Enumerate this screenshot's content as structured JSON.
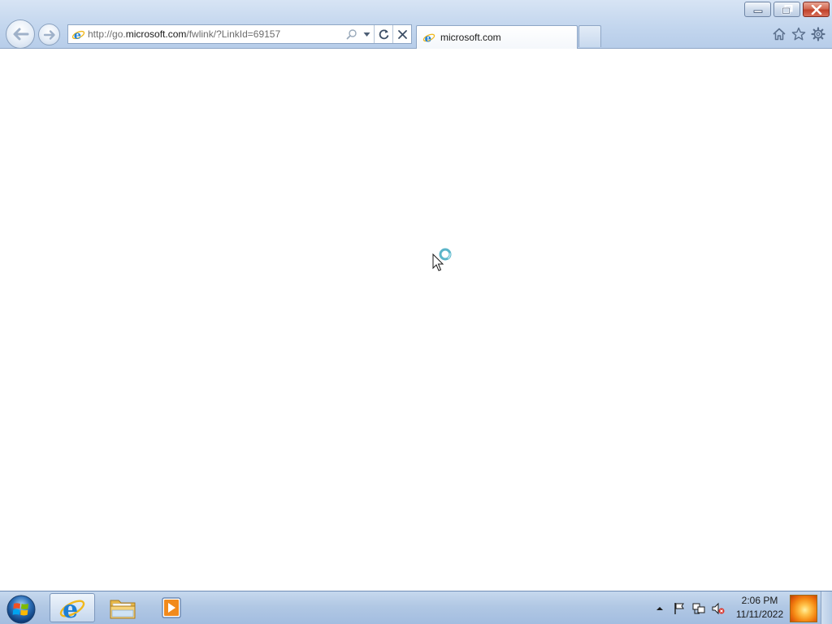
{
  "browser": {
    "address_url_prefix": "http://go.",
    "address_url_domain": "microsoft.com",
    "address_url_suffix": "/fwlink/?LinkId=69157",
    "tab_title": "microsoft.com"
  },
  "taskbar": {
    "clock_time": "2:06 PM",
    "clock_date": "11/11/2022",
    "apps": [
      "internet-explorer",
      "windows-explorer",
      "windows-media-player"
    ]
  },
  "colors": {
    "chrome_bg": "#c3d6ee",
    "taskbar_bg": "#b1c8e4",
    "close_button": "#c0412a",
    "ie_blue": "#1e7fd4",
    "ie_ring": "#f0b81c"
  }
}
